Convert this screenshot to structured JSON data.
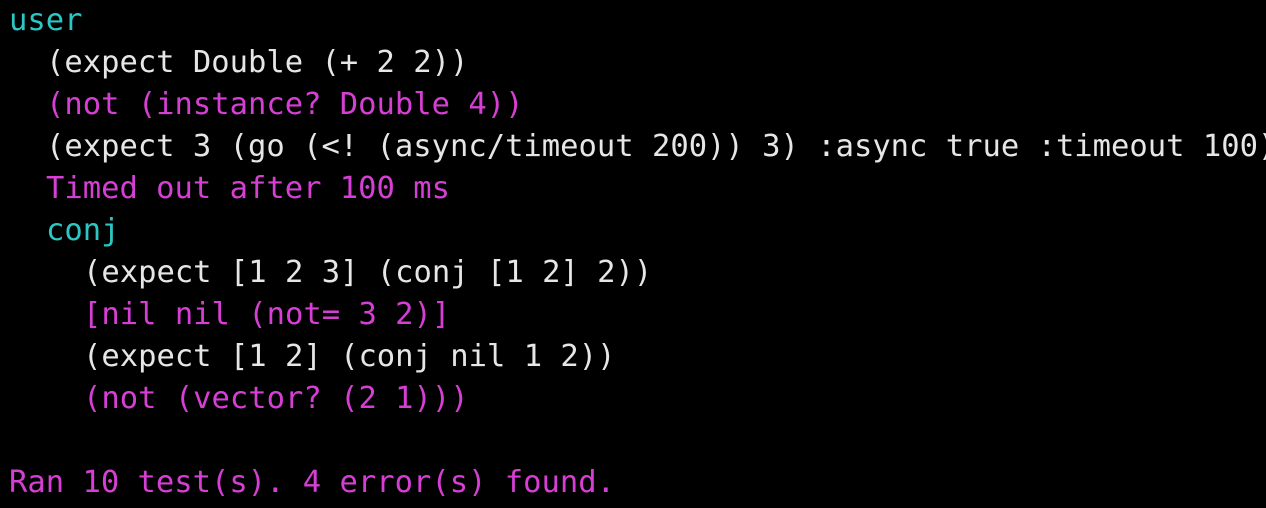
{
  "colors": {
    "background": "#000000",
    "default_text": "#e6e6e6",
    "error_text": "#d63fd3",
    "namespace_text": "#2cc7c4"
  },
  "output": {
    "namespace": "user",
    "lines": [
      {
        "text": "(expect Double (+ 2 2))",
        "kind": "default",
        "indent": 1
      },
      {
        "text": "(not (instance? Double 4))",
        "kind": "error",
        "indent": 1
      },
      {
        "text": "(expect 3 (go (<! (async/timeout 200)) 3) :async true :timeout 100)",
        "kind": "default",
        "indent": 1
      },
      {
        "text": "Timed out after 100 ms",
        "kind": "error",
        "indent": 1
      },
      {
        "text": "conj",
        "kind": "namespace",
        "indent": 1
      },
      {
        "text": "(expect [1 2 3] (conj [1 2] 2))",
        "kind": "default",
        "indent": 2
      },
      {
        "text": "[nil nil (not= 3 2)]",
        "kind": "error",
        "indent": 2
      },
      {
        "text": "(expect [1 2] (conj nil 1 2))",
        "kind": "default",
        "indent": 2
      },
      {
        "text": "(not (vector? (2 1)))",
        "kind": "error",
        "indent": 2
      }
    ],
    "summary": "Ran 10 test(s). 4 error(s) found."
  }
}
